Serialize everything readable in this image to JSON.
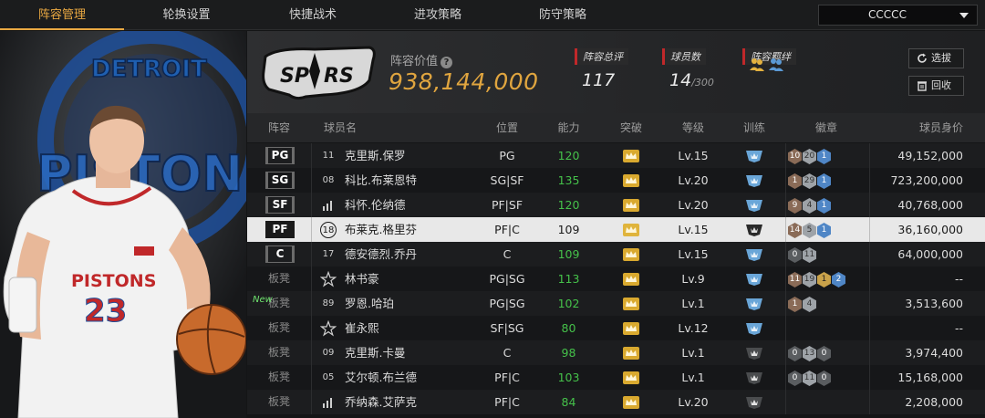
{
  "nav": {
    "tabs": [
      {
        "label": "阵容管理",
        "active": true
      },
      {
        "label": "轮换设置",
        "active": false
      },
      {
        "label": "快捷战术",
        "active": false
      },
      {
        "label": "进攻策略",
        "active": false
      },
      {
        "label": "防守策略",
        "active": false
      }
    ],
    "team_select": "CCCCC"
  },
  "header": {
    "value_label": "阵容价值",
    "value": "938,144,000",
    "overall_label": "阵容总评",
    "overall": "117",
    "players_label": "球员数",
    "players": "14",
    "players_max": "/300",
    "bond_label": "阵容羁绊",
    "buttons": {
      "pick": "选拔",
      "recycle": "回收"
    }
  },
  "table": {
    "headers": [
      "阵容",
      "球员名",
      "位置",
      "能力",
      "突破",
      "等级",
      "训练",
      "徽章",
      "球员身价"
    ],
    "new_tag": "New",
    "rows": [
      {
        "slot": "PG",
        "starter": true,
        "jersey": "11",
        "name": "克里斯.保罗",
        "pos": "PG",
        "ability": "120",
        "ability_color": "green",
        "crown": "gold",
        "level": "Lv.15",
        "train": "blue",
        "badges": [
          [
            "10",
            "bronze"
          ],
          [
            "20",
            "silver"
          ],
          [
            "1",
            "blue"
          ]
        ],
        "value": "49,152,000",
        "selected": false
      },
      {
        "slot": "SG",
        "starter": true,
        "jersey": "08",
        "name": "科比.布莱恩特",
        "pos": "SG|SF",
        "ability": "135",
        "ability_color": "green",
        "crown": "gold",
        "level": "Lv.20",
        "train": "blue",
        "badges": [
          [
            "1",
            "bronze"
          ],
          [
            "29",
            "silver"
          ],
          [
            "1",
            "blue"
          ]
        ],
        "value": "723,200,000",
        "selected": false
      },
      {
        "slot": "SF",
        "starter": true,
        "jersey": "bars",
        "name": "科怀.伦纳德",
        "pos": "PF|SF",
        "ability": "120",
        "ability_color": "green",
        "crown": "gold",
        "level": "Lv.20",
        "train": "blue",
        "badges": [
          [
            "9",
            "bronze"
          ],
          [
            "4",
            "silver"
          ],
          [
            "1",
            "blue"
          ]
        ],
        "value": "40,768,000",
        "selected": false
      },
      {
        "slot": "PF",
        "starter": true,
        "jersey": "18",
        "name": "布莱克.格里芬",
        "pos": "PF|C",
        "ability": "109",
        "ability_color": "dark",
        "crown": "gold",
        "level": "Lv.15",
        "train": "dark",
        "badges": [
          [
            "14",
            "bronze"
          ],
          [
            "5",
            "silver"
          ],
          [
            "1",
            "blue"
          ]
        ],
        "value": "36,160,000",
        "selected": true
      },
      {
        "slot": "C",
        "starter": true,
        "jersey": "17",
        "name": "德安德烈.乔丹",
        "pos": "C",
        "ability": "109",
        "ability_color": "green",
        "crown": "gold",
        "level": "Lv.15",
        "train": "blue",
        "badges": [
          [
            "0",
            "dark"
          ],
          [
            "11",
            "silver"
          ]
        ],
        "value": "64,000,000",
        "selected": false
      },
      {
        "slot": "板凳",
        "starter": false,
        "jersey": "star",
        "name": "林书豪",
        "pos": "PG|SG",
        "ability": "113",
        "ability_color": "green",
        "crown": "gold",
        "level": "Lv.9",
        "train": "blue",
        "badges": [
          [
            "11",
            "bronze"
          ],
          [
            "19",
            "silver"
          ],
          [
            "1",
            "gold"
          ],
          [
            "2",
            "blue"
          ]
        ],
        "value": "--",
        "selected": false
      },
      {
        "slot": "板凳",
        "starter": false,
        "jersey": "89",
        "name": "罗恩.哈珀",
        "pos": "PG|SG",
        "ability": "102",
        "ability_color": "green",
        "crown": "gold",
        "level": "Lv.1",
        "train": "blue",
        "badges": [
          [
            "1",
            "bronze"
          ],
          [
            "4",
            "silver"
          ]
        ],
        "value": "3,513,600",
        "selected": false
      },
      {
        "slot": "板凳",
        "starter": false,
        "jersey": "star",
        "name": "崔永熙",
        "pos": "SF|SG",
        "ability": "80",
        "ability_color": "green",
        "crown": "gold",
        "level": "Lv.12",
        "train": "blue",
        "badges": [],
        "value": "--",
        "selected": false
      },
      {
        "slot": "板凳",
        "starter": false,
        "jersey": "09",
        "name": "克里斯.卡曼",
        "pos": "C",
        "ability": "98",
        "ability_color": "green",
        "crown": "gold",
        "level": "Lv.1",
        "train": "dark",
        "badges": [
          [
            "0",
            "dark"
          ],
          [
            "13",
            "silver"
          ],
          [
            "0",
            "dark"
          ]
        ],
        "value": "3,974,400",
        "selected": false
      },
      {
        "slot": "板凳",
        "starter": false,
        "jersey": "05",
        "name": "艾尔顿.布兰德",
        "pos": "PF|C",
        "ability": "103",
        "ability_color": "green",
        "crown": "gold",
        "level": "Lv.1",
        "train": "dark",
        "badges": [
          [
            "0",
            "dark"
          ],
          [
            "11",
            "silver"
          ],
          [
            "0",
            "dark"
          ]
        ],
        "value": "15,168,000",
        "selected": false
      },
      {
        "slot": "板凳",
        "starter": false,
        "jersey": "bars",
        "name": "乔纳森.艾萨克",
        "pos": "PF|C",
        "ability": "84",
        "ability_color": "green",
        "crown": "gold",
        "level": "Lv.20",
        "train": "dark",
        "badges": [],
        "value": "2,208,000",
        "selected": false
      }
    ]
  },
  "art": {
    "jersey_text": "PISTONS",
    "jersey_number": "23",
    "bg_text_top": "DETROIT",
    "bg_text_mid": "PISTONS"
  }
}
